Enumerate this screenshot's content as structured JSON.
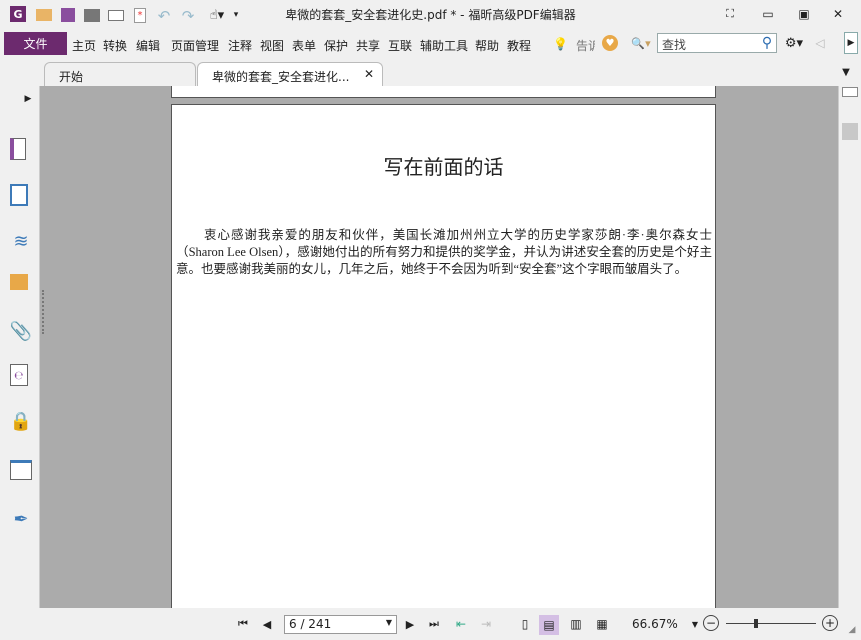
{
  "window": {
    "title": "卑微的套套_安全套进化史.pdf * - 福昕高级PDF编辑器"
  },
  "menu": {
    "file": "文件",
    "items": [
      "主页",
      "转换",
      "编辑",
      "页面管理",
      "注释",
      "视图",
      "表单",
      "保护",
      "共享",
      "互联",
      "辅助工具",
      "帮助",
      "教程"
    ],
    "tell_me": "告诉",
    "search_placeholder": "查找"
  },
  "tabs": [
    {
      "label": "开始"
    },
    {
      "label": "卑微的套套_安全套进化..."
    }
  ],
  "document": {
    "heading": "写在前面的话",
    "paragraph": "衷心感谢我亲爱的朋友和伙伴，美国长滩加州州立大学的历史学家莎朗·李·奥尔森女士（Sharon Lee Olsen），感谢她付出的所有努力和提供的奖学金，并认为讲述安全套的历史是个好主意。也要感谢我美丽的女儿，几年之后，她终于不会因为听到“安全套”这个字眼而皱眉头了。"
  },
  "status": {
    "page": "6 / 241",
    "zoom": "66.67%"
  },
  "colors": {
    "accent": "#6c2a6e"
  }
}
